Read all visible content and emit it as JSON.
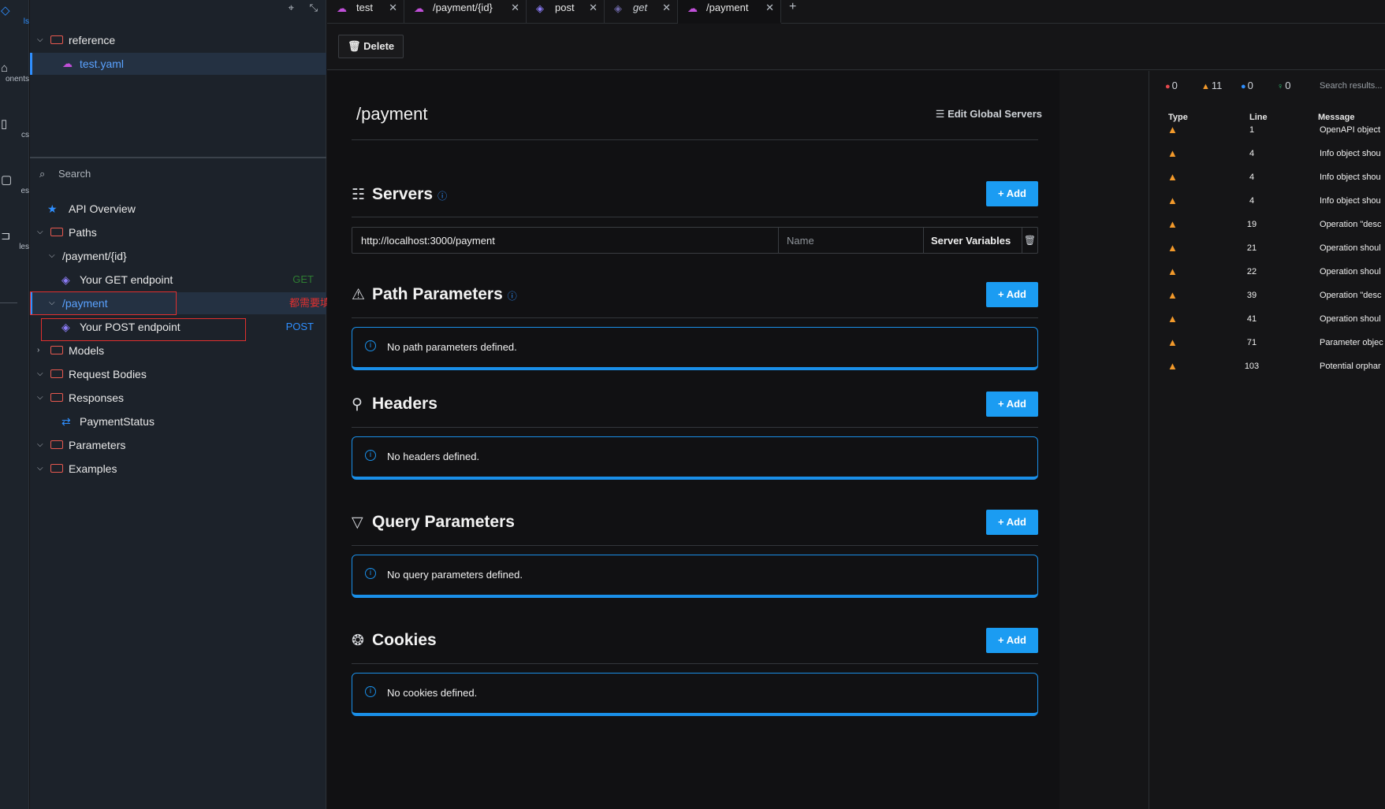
{
  "activity_bar": {
    "items": [
      {
        "label": "ls",
        "icon": "diamond-icon",
        "active": true
      },
      {
        "label": "onents",
        "icon": "cube-icon"
      },
      {
        "label": "cs",
        "icon": "book-icon"
      },
      {
        "label": "es",
        "icon": "square-icon"
      },
      {
        "label": "les",
        "icon": "link-icon"
      }
    ]
  },
  "sidebar": {
    "project": {
      "folder": "reference",
      "file": "test.yaml"
    },
    "search_placeholder": "Search",
    "tree": {
      "overview": "API Overview",
      "paths": "Paths",
      "path_id": "/payment/{id}",
      "get_endpoint": "Your GET endpoint",
      "get_method": "GET",
      "path_payment": "/payment",
      "annotation": "都需要填",
      "post_endpoint": "Your POST endpoint",
      "post_method": "POST",
      "models": "Models",
      "request_bodies": "Request Bodies",
      "responses": "Responses",
      "payment_status": "PaymentStatus",
      "parameters": "Parameters",
      "examples": "Examples"
    },
    "colors": {
      "folder": "#e8594f",
      "annotation": "#e1302f",
      "get": "#2e7d32",
      "post": "#2f8fff"
    }
  },
  "tabs": [
    {
      "label": "test",
      "icon": "cloud-icon"
    },
    {
      "label": "/payment/{id}",
      "icon": "cloud-icon"
    },
    {
      "label": "post",
      "icon": "endpoint-icon"
    },
    {
      "label": "get",
      "icon": "endpoint-icon"
    },
    {
      "label": "/payment",
      "icon": "cloud-icon",
      "active": true
    }
  ],
  "toolbar": {
    "delete_label": "Delete"
  },
  "main": {
    "title": "/payment",
    "edit_global_servers": "Edit Global Servers",
    "add_label": "Add",
    "servers": {
      "title": "Servers",
      "url": "http://localhost:3000/payment",
      "name_placeholder": "Name",
      "variables_label": "Server Variables"
    },
    "path_parameters": {
      "title": "Path Parameters",
      "empty": "No path parameters defined."
    },
    "headers": {
      "title": "Headers",
      "empty": "No headers defined."
    },
    "query_parameters": {
      "title": "Query Parameters",
      "empty": "No query parameters defined."
    },
    "cookies": {
      "title": "Cookies",
      "empty": "No cookies defined."
    }
  },
  "problems": {
    "counts": {
      "errors": "0",
      "warnings": "11",
      "infos": "0",
      "hints": "0"
    },
    "search_placeholder": "Search results...",
    "columns": {
      "type": "Type",
      "line": "Line",
      "message": "Message"
    },
    "rows": [
      {
        "line": "1",
        "message": "OpenAPI object"
      },
      {
        "line": "4",
        "message": "Info object shou"
      },
      {
        "line": "4",
        "message": "Info object shou"
      },
      {
        "line": "4",
        "message": "Info object shou"
      },
      {
        "line": "19",
        "message": "Operation \"desc"
      },
      {
        "line": "21",
        "message": "Operation shoul"
      },
      {
        "line": "22",
        "message": "Operation shoul"
      },
      {
        "line": "39",
        "message": "Operation \"desc"
      },
      {
        "line": "41",
        "message": "Operation shoul"
      },
      {
        "line": "71",
        "message": "Parameter objec"
      },
      {
        "line": "103",
        "message": "Potential orphar"
      }
    ],
    "colors": {
      "error": "#e5484d",
      "warning": "#f39a2b",
      "info": "#2f8fff",
      "hint": "#2fbf71"
    }
  }
}
